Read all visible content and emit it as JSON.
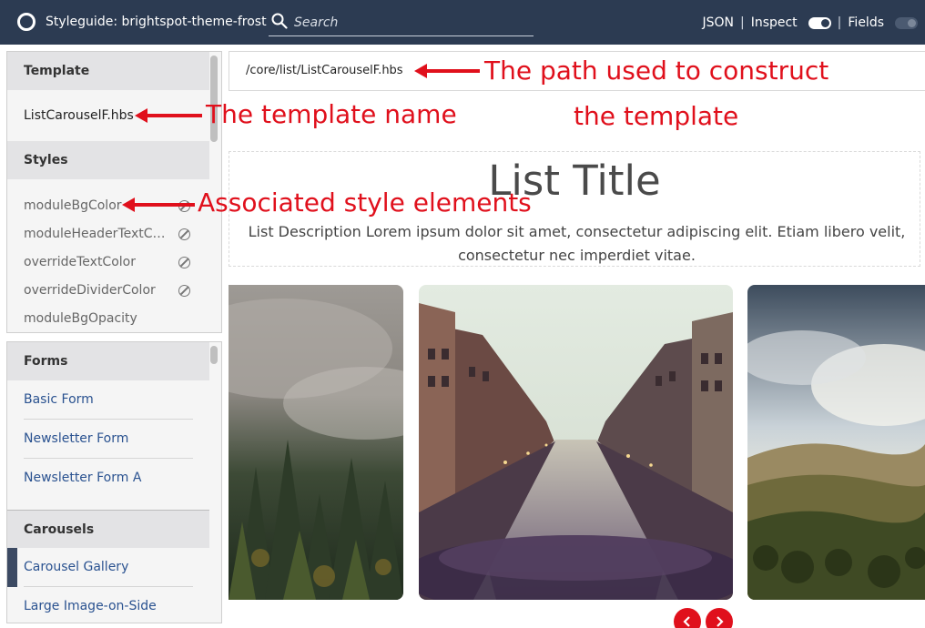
{
  "header": {
    "title": "Styleguide: brightspot-theme-frost",
    "search_placeholder": "Search",
    "json_label": "JSON",
    "sep": "|",
    "inspect_label": "Inspect",
    "inspect_on": true,
    "fields_label": "Fields",
    "fields_on": false
  },
  "sidebar_top": {
    "template_heading": "Template",
    "template_name": "ListCarouselF.hbs",
    "styles_heading": "Styles",
    "styles": [
      "moduleBgColor",
      "moduleHeaderTextColor",
      "overrideTextColor",
      "overrideDividerColor",
      "moduleBgOpacity"
    ]
  },
  "sidebar_bottom": {
    "forms_heading": "Forms",
    "forms": [
      "Basic Form",
      "Newsletter Form",
      "Newsletter Form A"
    ],
    "carousels_heading": "Carousels",
    "carousels": [
      "Carousel Gallery",
      "Large Image-on-Side"
    ],
    "active_item": "Carousel Gallery"
  },
  "main": {
    "path": "/core/list/ListCarouselF.hbs",
    "list_title": "List Title",
    "list_description": "List Description Lorem ipsum dolor sit amet, consectetur adipiscing elit. Etiam libero velit, consectetur nec imperdiet vitae."
  },
  "annotations": {
    "path": "The path used to construct",
    "path_line2": "the template",
    "template_name": "The template name",
    "styles": "Associated style elements"
  },
  "colors": {
    "topbar": "#2c3b52",
    "annotation": "#e0101c",
    "link": "#2a5290",
    "active_marker": "#3c4a63"
  },
  "icons": [
    "logo-icon",
    "search-icon",
    "toggle-icon",
    "ban-icon",
    "chevron-left-icon",
    "chevron-right-icon"
  ]
}
